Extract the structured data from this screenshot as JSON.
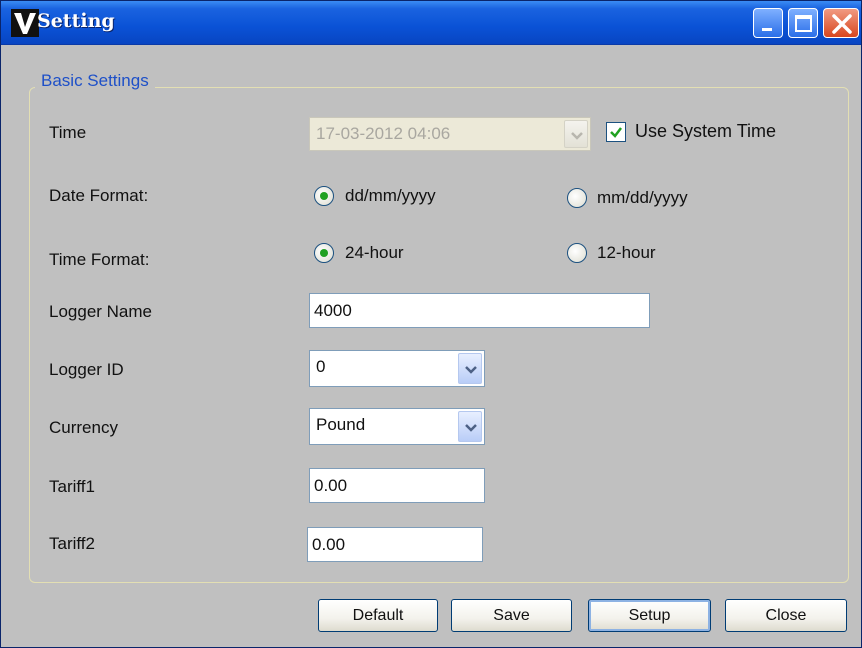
{
  "window": {
    "title": "Setting"
  },
  "group": {
    "legend": "Basic Settings"
  },
  "time": {
    "label": "Time",
    "value": "17-03-2012 04:06",
    "use_system_time_label": "Use System Time",
    "use_system_time_checked": true
  },
  "date_format": {
    "label": "Date Format:",
    "options": [
      "dd/mm/yyyy",
      "mm/dd/yyyy"
    ],
    "selected": "dd/mm/yyyy"
  },
  "time_format": {
    "label": "Time Format:",
    "options": [
      "24-hour",
      "12-hour"
    ],
    "selected": "24-hour"
  },
  "logger_name": {
    "label": "Logger Name",
    "value": "4000"
  },
  "logger_id": {
    "label": "Logger ID",
    "value": "0"
  },
  "currency": {
    "label": "Currency",
    "value": "Pound"
  },
  "tariff1": {
    "label": "Tariff1",
    "value": "0.00"
  },
  "tariff2": {
    "label": "Tariff2",
    "value": "0.00"
  },
  "buttons": {
    "default": "Default",
    "save": "Save",
    "setup": "Setup",
    "close": "Close"
  },
  "colors": {
    "title_bar": "#0a52d6",
    "legend_text": "#1e50c8",
    "window_bg": "#c0c0c0",
    "radio_dot": "#21a121"
  }
}
